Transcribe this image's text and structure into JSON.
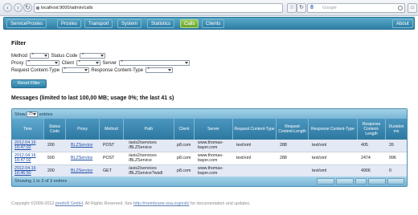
{
  "browser": {
    "url": "localhost:9000/admin/calls",
    "search_engine": "Google"
  },
  "nav": {
    "tabs": [
      {
        "label": "ServiceProxies"
      },
      {
        "label": "Proxies"
      },
      {
        "label": "Transport"
      },
      {
        "label": "System"
      },
      {
        "label": "Statistics"
      },
      {
        "label": "Calls"
      },
      {
        "label": "Clients"
      }
    ],
    "active": "Calls",
    "about": "About"
  },
  "filter": {
    "title": "Filter",
    "method_label": "Method",
    "status_code_label": "Status Code",
    "proxy_label": "Proxy",
    "client_label": "Client",
    "server_label": "Server",
    "request_ct_label": "Request Content-Type",
    "response_ct_label": "Response Content-Type",
    "select_value": "*",
    "reset_label": "Reset Filter"
  },
  "messages": {
    "title": "Messages (limited to last 100,00 MB; usage 0%; the last 41 s)",
    "show_label": "Show",
    "show_value": "25",
    "entries_label": "entries",
    "columns": [
      "Time",
      "Status Code",
      "Proxy",
      "Method",
      "Path",
      "Client",
      "Server",
      "Request Content-Type",
      "Request Content-Length",
      "Response Content-Type",
      "Response Content-Length",
      "Duration ms"
    ],
    "rows": [
      {
        "date": "2012.04.16",
        "time": "16:47:02",
        "status": "200",
        "proxy": "BLZService",
        "method": "POST",
        "path1": "/axis2/services",
        "path2": "/BLZService",
        "client": "p8.com",
        "server1": "www.thomas-",
        "server2": "bayer.com",
        "req_ct": "text/xml",
        "req_len": "288",
        "resp_ct": "text/xml",
        "resp_len": "405",
        "duration": "26"
      },
      {
        "date": "2012.04.16",
        "time": "16:47:02",
        "status": "500",
        "proxy": "BLZService",
        "method": "POST",
        "path1": "/axis2/services",
        "path2": "/BLZService",
        "client": "p8.com",
        "server1": "www.thomas-",
        "server2": "bayer.com",
        "req_ct": "text/xml",
        "req_len": "288",
        "resp_ct": "text/xml",
        "resp_len": "2474",
        "duration": "996"
      },
      {
        "date": "2012.04.16",
        "time": "16:46:50",
        "status": "200",
        "proxy": "BLZService",
        "method": "GET",
        "path1": "/axis2/services",
        "path2": "/BLZService?wsdl",
        "client": "p8.com",
        "server1": "www.thomas-",
        "server2": "bayer.com",
        "req_ct": "",
        "req_len": "",
        "resp_ct": "text/xml",
        "resp_len": "4906",
        "duration": "0"
      }
    ],
    "showing": "Showing 1 to 3 of 3 entries"
  },
  "footer": {
    "prefix": "Copyright ©2009-2012",
    "company": "predic8 GmbH",
    "middle": ". All Rights Reserved. See",
    "link": "http://membrane-soa.org/esb/",
    "suffix": "for documentation and updates."
  }
}
